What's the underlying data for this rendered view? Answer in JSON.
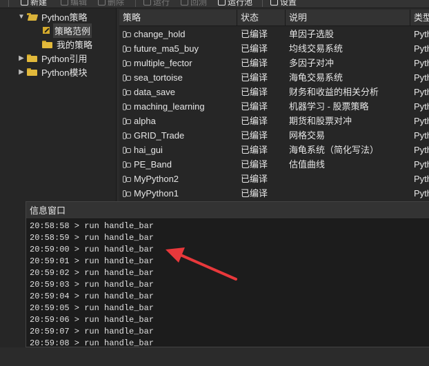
{
  "toolbar": {
    "items": [
      {
        "label": "新建",
        "icon": "new-icon",
        "enabled": true
      },
      {
        "label": "编辑",
        "icon": "edit-icon",
        "enabled": false
      },
      {
        "label": "删除",
        "icon": "delete-icon",
        "enabled": false
      },
      {
        "label": "运行",
        "icon": "run-icon",
        "enabled": false
      },
      {
        "label": "回测",
        "icon": "backtest-icon",
        "enabled": false
      },
      {
        "label": "运行池",
        "icon": "run-pool-icon",
        "enabled": true
      },
      {
        "label": "设置",
        "icon": "gear-icon",
        "enabled": true
      }
    ]
  },
  "tree": {
    "items": [
      {
        "label": "Python策略",
        "expanded": true
      },
      {
        "label": "策略范例",
        "selected": true
      },
      {
        "label": "我的策略"
      },
      {
        "label": "Python引用",
        "expanded": false
      },
      {
        "label": "Python模块",
        "expanded": false
      }
    ]
  },
  "table": {
    "headers": [
      "策略",
      "状态",
      "说明",
      "类型"
    ],
    "rows": [
      {
        "name": "change_hold",
        "status": "已编译",
        "desc": "单因子选股",
        "type": "Pyth"
      },
      {
        "name": "future_ma5_buy",
        "status": "已编译",
        "desc": "均线交易系统",
        "type": "Pyth"
      },
      {
        "name": "multiple_fector",
        "status": "已编译",
        "desc": "多因子对冲",
        "type": "Pyth"
      },
      {
        "name": "sea_tortoise",
        "status": "已编译",
        "desc": "海龟交易系统",
        "type": "Pyth"
      },
      {
        "name": "data_save",
        "status": "已编译",
        "desc": "财务和收益的相关分析",
        "type": "Pyth"
      },
      {
        "name": "maching_learning",
        "status": "已编译",
        "desc": "机器学习 - 股票策略",
        "type": "Pyth"
      },
      {
        "name": "alpha",
        "status": "已编译",
        "desc": "期货和股票对冲",
        "type": "Pyth"
      },
      {
        "name": "GRID_Trade",
        "status": "已编译",
        "desc": "网格交易",
        "type": "Pyth"
      },
      {
        "name": "hai_gui",
        "status": "已编译",
        "desc": "海龟系统（简化写法）",
        "type": "Pyth"
      },
      {
        "name": "PE_Band",
        "status": "已编译",
        "desc": "估值曲线",
        "type": "Pyth"
      },
      {
        "name": "MyPython2",
        "status": "已编译",
        "desc": "",
        "type": "Pyth"
      },
      {
        "name": "MyPython1",
        "status": "已编译",
        "desc": "",
        "type": "Pyth"
      }
    ]
  },
  "message_window": {
    "title": "信息窗口",
    "lines": [
      "20:58:58 > run handle_bar",
      "20:58:59 > run handle_bar",
      "20:59:00 > run handle_bar",
      "20:59:01 > run handle_bar",
      "20:59:02 > run handle_bar",
      "20:59:03 > run handle_bar",
      "20:59:04 > run handle_bar",
      "20:59:05 > run handle_bar",
      "20:59:06 > run handle_bar",
      "20:59:07 > run handle_bar",
      "20:59:08 > run handle_bar"
    ]
  },
  "colors": {
    "annotation_arrow": "#e8383b",
    "folder": "#e2b93b"
  }
}
